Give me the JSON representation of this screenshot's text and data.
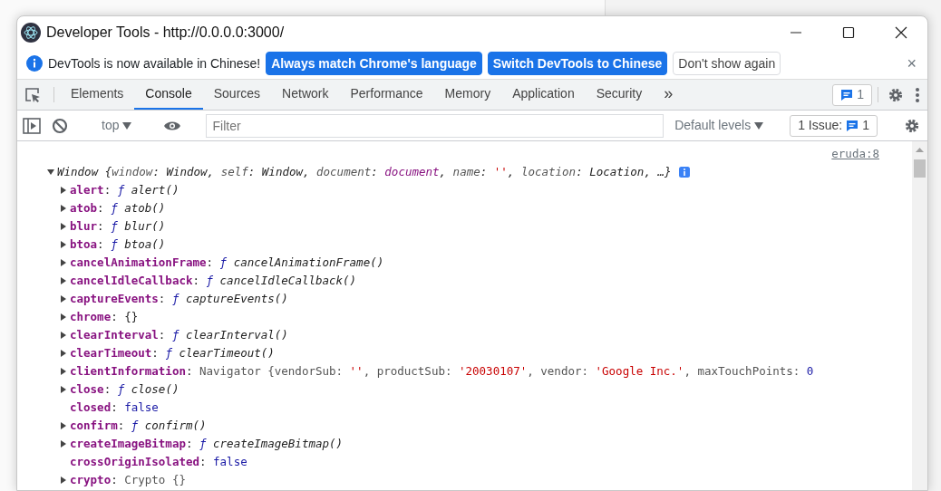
{
  "window": {
    "title": "Developer Tools - http://0.0.0.0:3000/"
  },
  "infobar": {
    "message": "DevTools is now available in Chinese!",
    "buttons": [
      {
        "label": "Always match Chrome's language",
        "kind": "primary"
      },
      {
        "label": "Switch DevTools to Chinese",
        "kind": "primary"
      },
      {
        "label": "Don't show again",
        "kind": "outline"
      }
    ],
    "close": "×"
  },
  "tabs": [
    {
      "label": "Elements",
      "selected": false
    },
    {
      "label": "Console",
      "selected": true
    },
    {
      "label": "Sources",
      "selected": false
    },
    {
      "label": "Network",
      "selected": false
    },
    {
      "label": "Performance",
      "selected": false
    },
    {
      "label": "Memory",
      "selected": false
    },
    {
      "label": "Application",
      "selected": false
    },
    {
      "label": "Security",
      "selected": false
    }
  ],
  "more_tabs": "»",
  "issues_badge": "1",
  "console_toolbar": {
    "context": "top",
    "filter_placeholder": "Filter",
    "levels": "Default levels",
    "issues_label": "1 Issue:",
    "issues_count": "1"
  },
  "console": {
    "source_link": "eruda:8",
    "summary": {
      "expanded": true,
      "tokens": [
        {
          "text": "Window ",
          "kind": "name"
        },
        {
          "text": "{",
          "kind": "punct"
        },
        {
          "text": "window",
          "kind": "key"
        },
        {
          "text": ": ",
          "kind": "punct"
        },
        {
          "text": "Window",
          "kind": "name"
        },
        {
          "text": ", ",
          "kind": "punct"
        },
        {
          "text": "self",
          "kind": "key"
        },
        {
          "text": ": ",
          "kind": "punct"
        },
        {
          "text": "Window",
          "kind": "name"
        },
        {
          "text": ", ",
          "kind": "punct"
        },
        {
          "text": "document",
          "kind": "key"
        },
        {
          "text": ": ",
          "kind": "punct"
        },
        {
          "text": "document",
          "kind": "node"
        },
        {
          "text": ", ",
          "kind": "punct"
        },
        {
          "text": "name",
          "kind": "key"
        },
        {
          "text": ": ",
          "kind": "punct"
        },
        {
          "text": "''",
          "kind": "string"
        },
        {
          "text": ", ",
          "kind": "punct"
        },
        {
          "text": "location",
          "kind": "key"
        },
        {
          "text": ": ",
          "kind": "punct"
        },
        {
          "text": "Location",
          "kind": "name"
        },
        {
          "text": ", …}",
          "kind": "punct"
        }
      ]
    },
    "properties": [
      {
        "key": "alert",
        "expandable": true,
        "tokens": [
          {
            "text": ": ",
            "kind": "punct"
          },
          {
            "text": "ƒ ",
            "kind": "f"
          },
          {
            "text": "alert()",
            "kind": "fname"
          }
        ]
      },
      {
        "key": "atob",
        "expandable": true,
        "tokens": [
          {
            "text": ": ",
            "kind": "punct"
          },
          {
            "text": "ƒ ",
            "kind": "f"
          },
          {
            "text": "atob()",
            "kind": "fname"
          }
        ]
      },
      {
        "key": "blur",
        "expandable": true,
        "tokens": [
          {
            "text": ": ",
            "kind": "punct"
          },
          {
            "text": "ƒ ",
            "kind": "f"
          },
          {
            "text": "blur()",
            "kind": "fname"
          }
        ]
      },
      {
        "key": "btoa",
        "expandable": true,
        "tokens": [
          {
            "text": ": ",
            "kind": "punct"
          },
          {
            "text": "ƒ ",
            "kind": "f"
          },
          {
            "text": "btoa()",
            "kind": "fname"
          }
        ]
      },
      {
        "key": "cancelAnimationFrame",
        "expandable": true,
        "tokens": [
          {
            "text": ": ",
            "kind": "punct"
          },
          {
            "text": "ƒ ",
            "kind": "f"
          },
          {
            "text": "cancelAnimationFrame()",
            "kind": "fname"
          }
        ]
      },
      {
        "key": "cancelIdleCallback",
        "expandable": true,
        "tokens": [
          {
            "text": ": ",
            "kind": "punct"
          },
          {
            "text": "ƒ ",
            "kind": "f"
          },
          {
            "text": "cancelIdleCallback()",
            "kind": "fname"
          }
        ]
      },
      {
        "key": "captureEvents",
        "expandable": true,
        "tokens": [
          {
            "text": ": ",
            "kind": "punct"
          },
          {
            "text": "ƒ ",
            "kind": "f"
          },
          {
            "text": "captureEvents()",
            "kind": "fname"
          }
        ]
      },
      {
        "key": "chrome",
        "expandable": true,
        "tokens": [
          {
            "text": ": ",
            "kind": "punct"
          },
          {
            "text": "{}",
            "kind": "punct"
          }
        ]
      },
      {
        "key": "clearInterval",
        "expandable": true,
        "tokens": [
          {
            "text": ": ",
            "kind": "punct"
          },
          {
            "text": "ƒ ",
            "kind": "f"
          },
          {
            "text": "clearInterval()",
            "kind": "fname"
          }
        ]
      },
      {
        "key": "clearTimeout",
        "expandable": true,
        "tokens": [
          {
            "text": ": ",
            "kind": "punct"
          },
          {
            "text": "ƒ ",
            "kind": "f"
          },
          {
            "text": "clearTimeout()",
            "kind": "fname"
          }
        ]
      },
      {
        "key": "clientInformation",
        "expandable": true,
        "tokens": [
          {
            "text": ": ",
            "kind": "punct"
          },
          {
            "text": "Navigator ",
            "kind": "plain"
          },
          {
            "text": "{vendorSub: ",
            "kind": "plain"
          },
          {
            "text": "''",
            "kind": "string"
          },
          {
            "text": ", productSub: ",
            "kind": "plain"
          },
          {
            "text": "'20030107'",
            "kind": "string"
          },
          {
            "text": ", vendor: ",
            "kind": "plain"
          },
          {
            "text": "'Google Inc.'",
            "kind": "string"
          },
          {
            "text": ", maxTouchPoints: ",
            "kind": "plain"
          },
          {
            "text": "0",
            "kind": "number"
          }
        ]
      },
      {
        "key": "close",
        "expandable": true,
        "tokens": [
          {
            "text": ": ",
            "kind": "punct"
          },
          {
            "text": "ƒ ",
            "kind": "f"
          },
          {
            "text": "close()",
            "kind": "fname"
          }
        ]
      },
      {
        "key": "closed",
        "expandable": false,
        "tokens": [
          {
            "text": ": ",
            "kind": "punct"
          },
          {
            "text": "false",
            "kind": "number"
          }
        ]
      },
      {
        "key": "confirm",
        "expandable": true,
        "tokens": [
          {
            "text": ": ",
            "kind": "punct"
          },
          {
            "text": "ƒ ",
            "kind": "f"
          },
          {
            "text": "confirm()",
            "kind": "fname"
          }
        ]
      },
      {
        "key": "createImageBitmap",
        "expandable": true,
        "tokens": [
          {
            "text": ": ",
            "kind": "punct"
          },
          {
            "text": "ƒ ",
            "kind": "f"
          },
          {
            "text": "createImageBitmap()",
            "kind": "fname"
          }
        ]
      },
      {
        "key": "crossOriginIsolated",
        "expandable": false,
        "tokens": [
          {
            "text": ": ",
            "kind": "punct"
          },
          {
            "text": "false",
            "kind": "number"
          }
        ]
      },
      {
        "key": "crypto",
        "expandable": true,
        "tokens": [
          {
            "text": ": ",
            "kind": "punct"
          },
          {
            "text": "Crypto ",
            "kind": "plain"
          },
          {
            "text": "{}",
            "kind": "plain"
          }
        ]
      }
    ]
  }
}
